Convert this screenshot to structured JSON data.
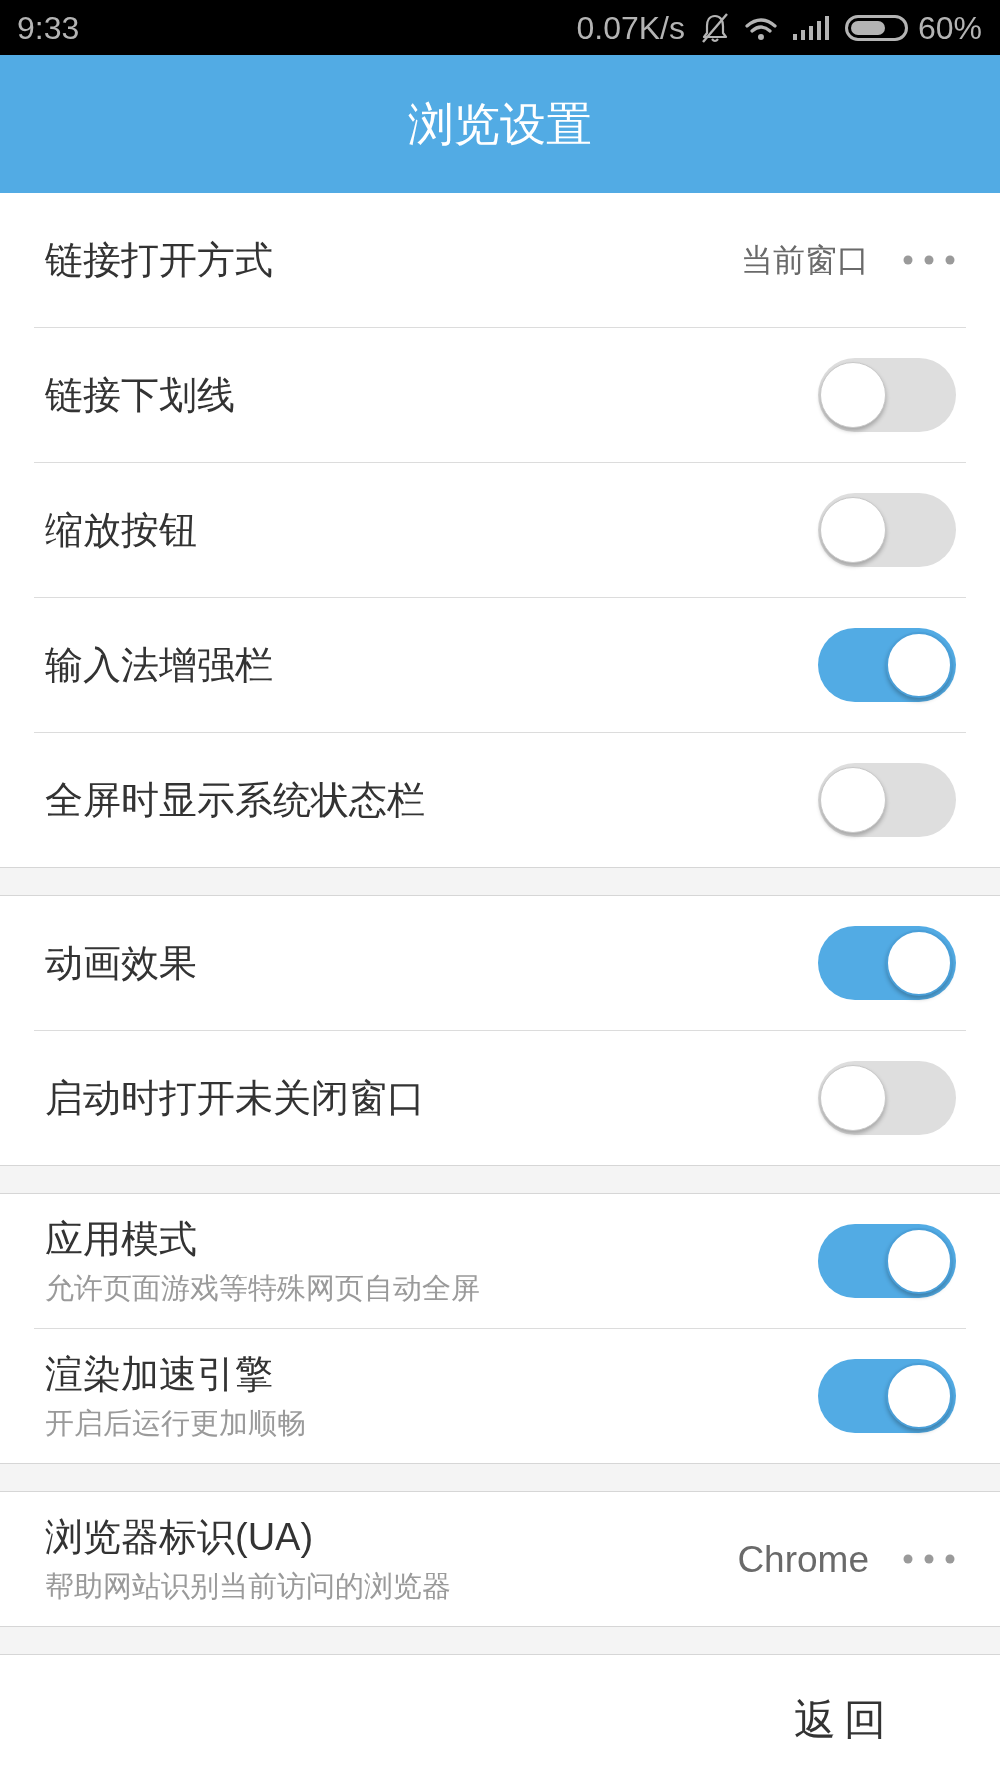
{
  "status_bar": {
    "time": "9:33",
    "network_speed": "0.07K/s",
    "battery": "60%"
  },
  "header": {
    "title": "浏览设置"
  },
  "sections": [
    {
      "items": [
        {
          "kind": "choice",
          "label": "链接打开方式",
          "value": "当前窗口"
        },
        {
          "kind": "toggle",
          "label": "链接下划线",
          "on": false
        },
        {
          "kind": "toggle",
          "label": "缩放按钮",
          "on": false
        },
        {
          "kind": "toggle",
          "label": "输入法增强栏",
          "on": true
        },
        {
          "kind": "toggle",
          "label": "全屏时显示系统状态栏",
          "on": false
        }
      ]
    },
    {
      "items": [
        {
          "kind": "toggle",
          "label": "动画效果",
          "on": true
        },
        {
          "kind": "toggle",
          "label": "启动时打开未关闭窗口",
          "on": false
        }
      ]
    },
    {
      "items": [
        {
          "kind": "toggle",
          "label": "应用模式",
          "subtitle": "允许页面游戏等特殊网页自动全屏",
          "on": true
        },
        {
          "kind": "toggle",
          "label": "渲染加速引擎",
          "subtitle": "开启后运行更加顺畅",
          "on": true
        }
      ]
    },
    {
      "items": [
        {
          "kind": "choice",
          "label": "浏览器标识(UA)",
          "subtitle": "帮助网站识别当前访问的浏览器",
          "value": "Chrome"
        }
      ]
    }
  ],
  "footer": {
    "button": "返回"
  }
}
